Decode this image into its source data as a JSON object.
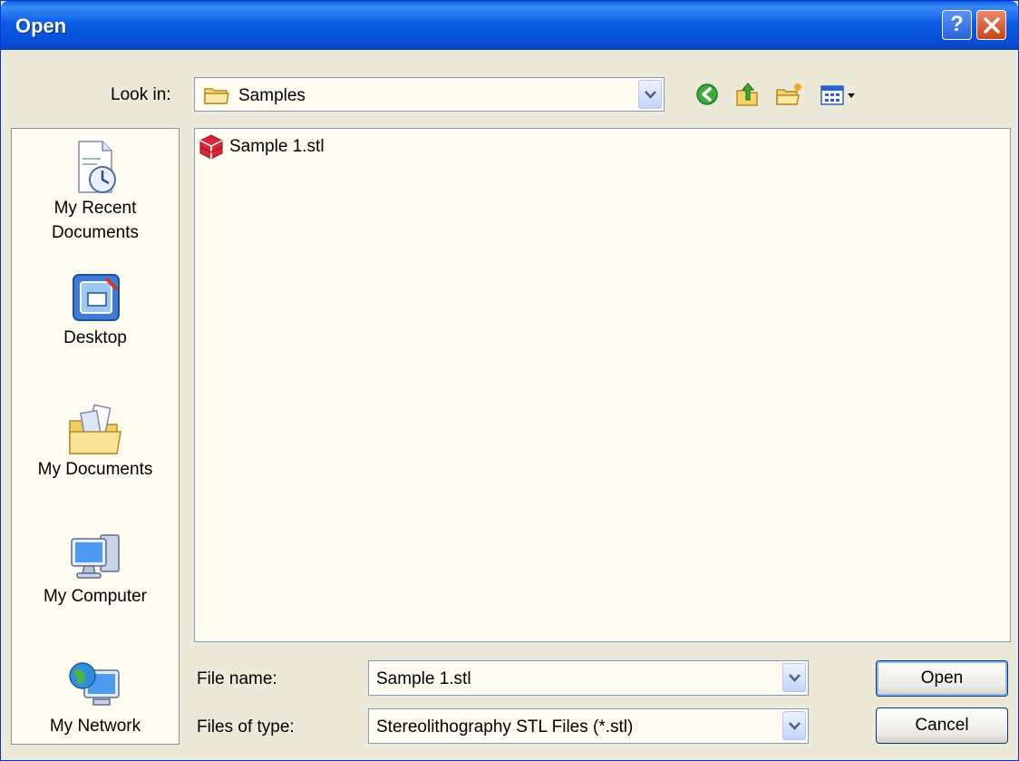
{
  "window": {
    "title": "Open"
  },
  "titlebar": {
    "help_label": "?",
    "close_label": "✕"
  },
  "lookin": {
    "label": "Look in:",
    "value": "Samples"
  },
  "toolbar": [
    {
      "name": "back-button",
      "icon": "back-arrow-icon"
    },
    {
      "name": "up-one-level-button",
      "icon": "up-folder-icon"
    },
    {
      "name": "create-new-folder-button",
      "icon": "new-folder-icon"
    },
    {
      "name": "view-menu-button",
      "icon": "views-icon"
    }
  ],
  "places": [
    {
      "label": "My Recent Documents",
      "icon": "recent-documents-icon"
    },
    {
      "label": "Desktop",
      "icon": "desktop-icon"
    },
    {
      "label": "My Documents",
      "icon": "my-documents-icon"
    },
    {
      "label": "My Computer",
      "icon": "my-computer-icon"
    },
    {
      "label": "My Network",
      "icon": "my-network-icon"
    }
  ],
  "files": [
    {
      "name": "Sample 1.stl",
      "icon": "stl-file-icon"
    }
  ],
  "filename": {
    "label": "File name:",
    "value": "Sample 1.stl"
  },
  "filetype": {
    "label": "Files of type:",
    "value": "Stereolithography STL Files (*.stl)"
  },
  "buttons": {
    "open": "Open",
    "cancel": "Cancel"
  },
  "colors": {
    "titlebar": "#0A5FE0",
    "dialog_bg": "#ECE9D8",
    "list_bg": "#FEFCF1",
    "close": "#C9431C"
  }
}
